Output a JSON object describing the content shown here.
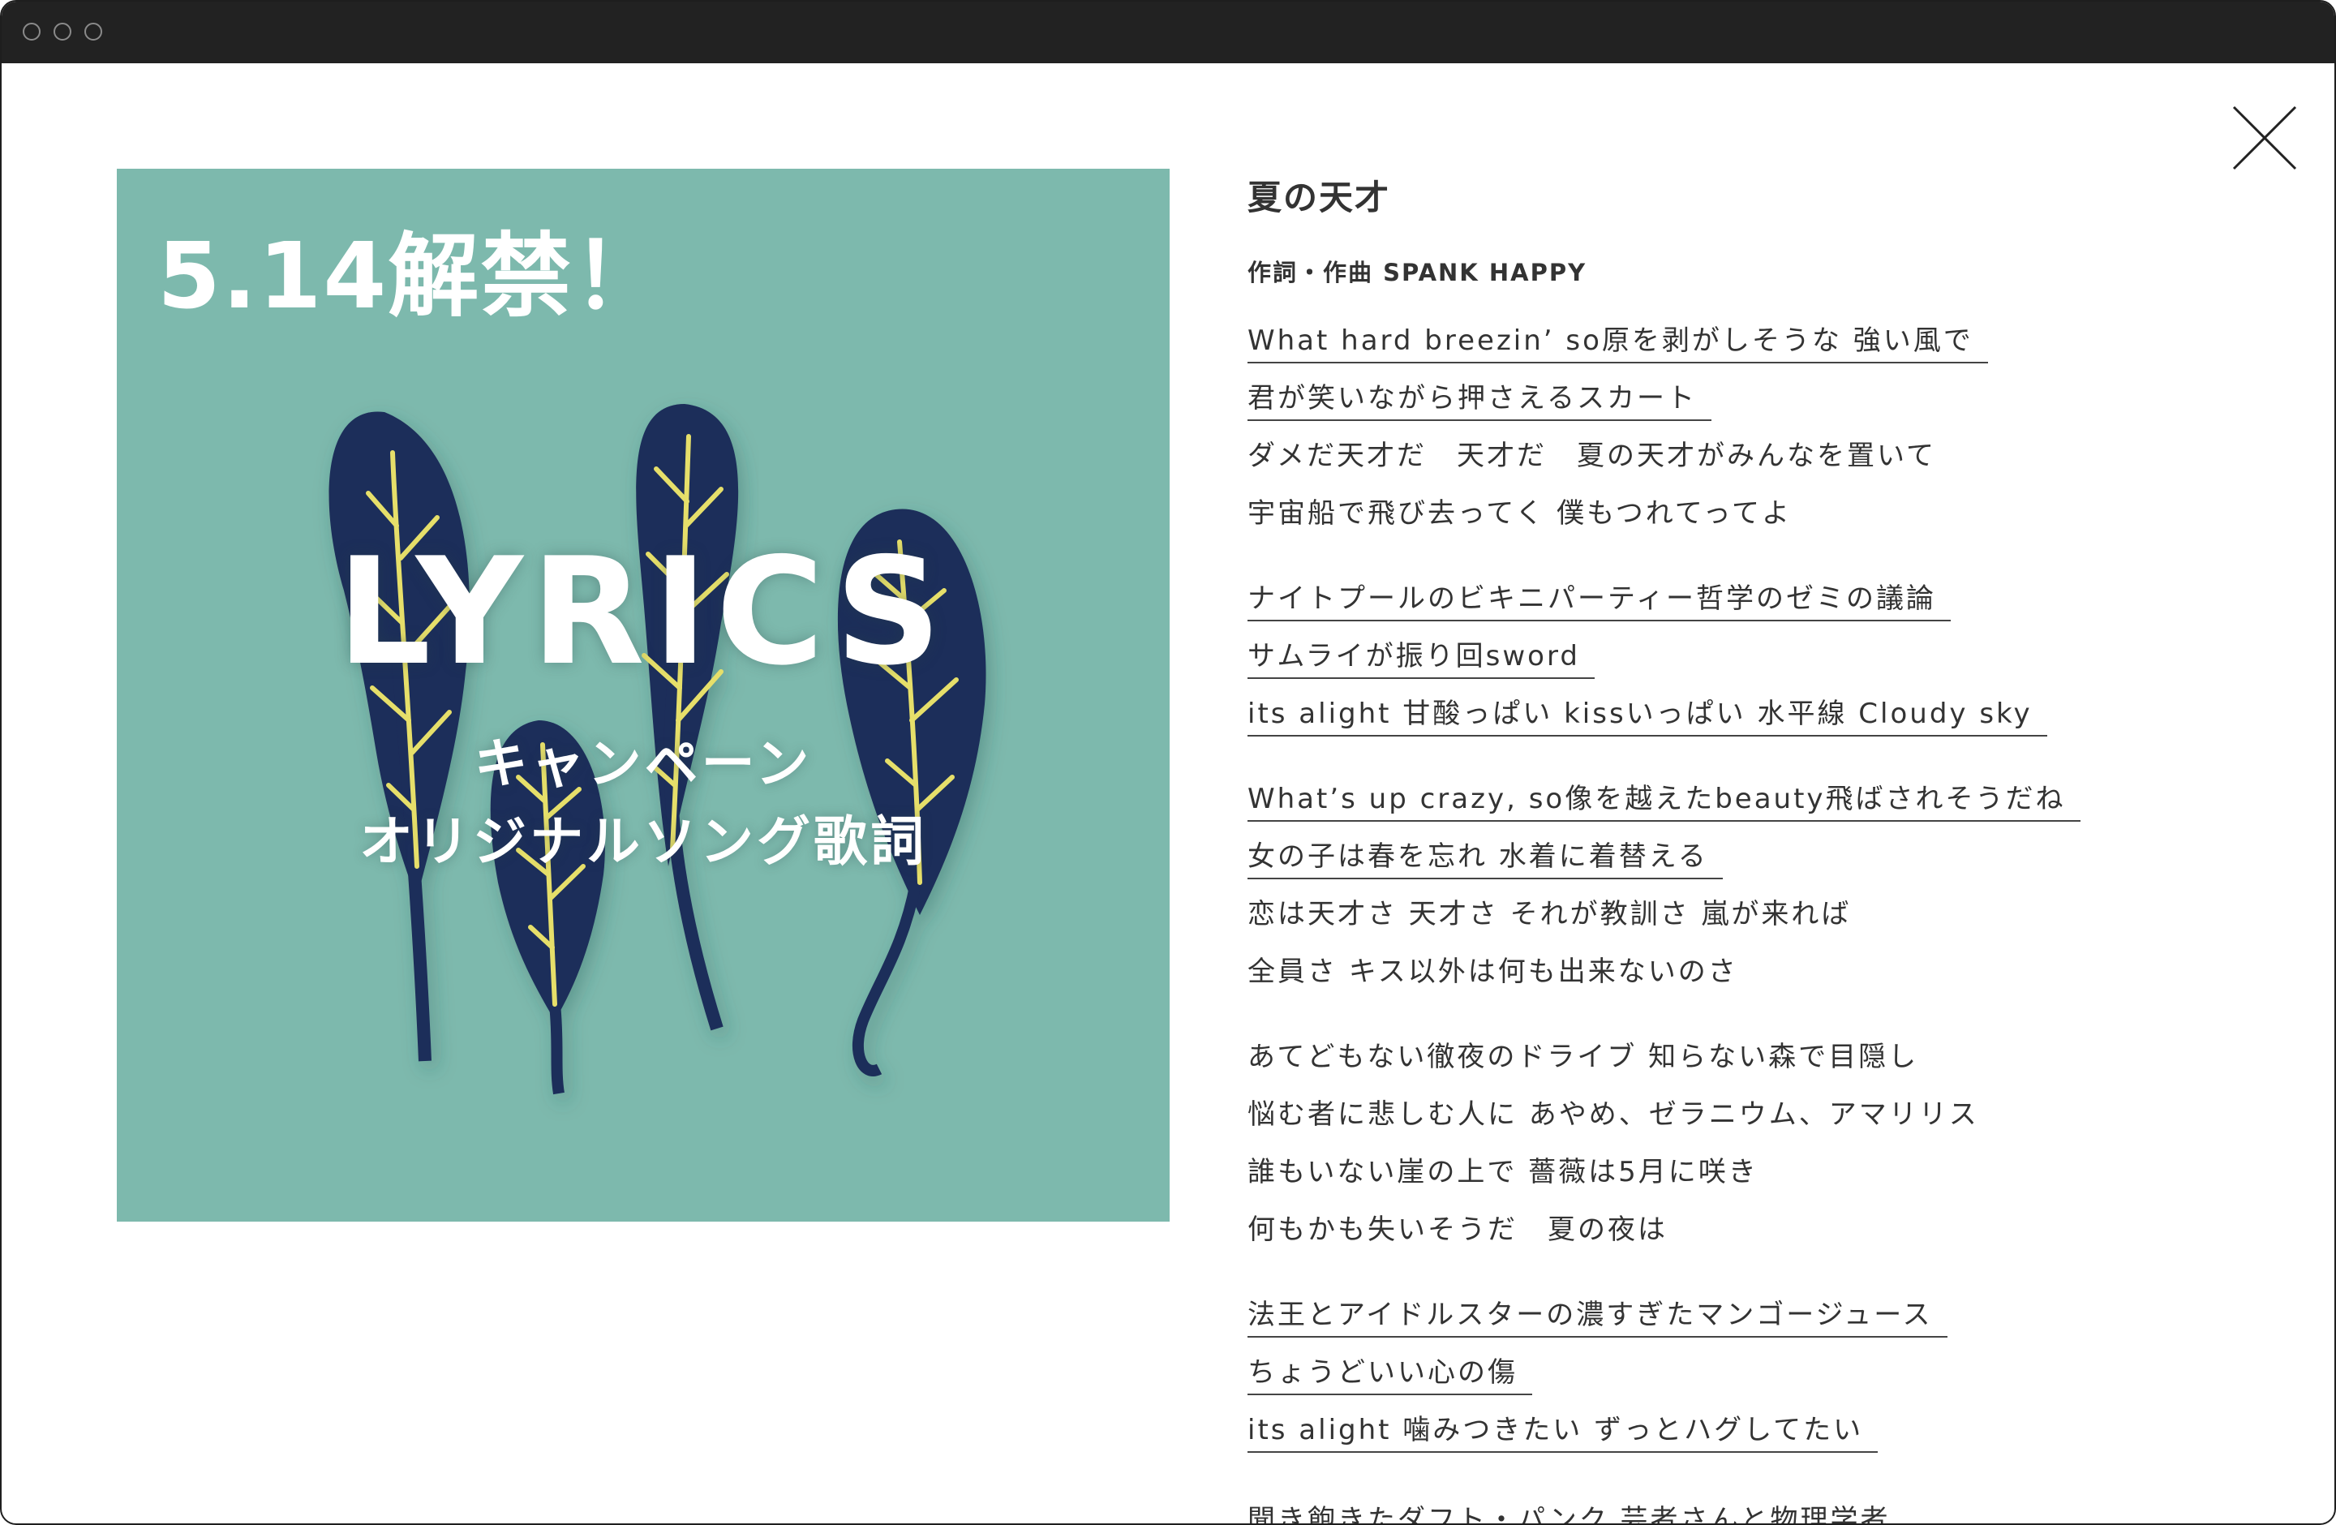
{
  "window": {
    "title": "",
    "controls": [
      "window-control",
      "window-control",
      "window-control"
    ]
  },
  "artwork": {
    "date_text": "5.14解禁！",
    "title_text": "LYRICS",
    "subtitle_line1": "キャンペーン",
    "subtitle_line2": "オリジナルソング歌詞",
    "background_color": "#7db9ad",
    "leaf_color": "#1c2d5a",
    "vein_color": "#e6df6a"
  },
  "close_icon": "close-icon",
  "song": {
    "title": "夏の天才",
    "credit": "作詞・作曲 SPANK HAPPY",
    "stanzas": [
      {
        "lines": [
          {
            "text": "What hard breezin’ so原を剥がしそうな 強い風で",
            "underlined": true
          },
          {
            "text": "君が笑いながら押さえるスカート",
            "underlined": true
          },
          {
            "text": "ダメだ天才だ　天才だ　夏の天才がみんなを置いて",
            "underlined": false
          },
          {
            "text": "宇宙船で飛び去ってく 僕もつれてってよ",
            "underlined": false
          }
        ]
      },
      {
        "lines": [
          {
            "text": "ナイトプールのビキニパーティー哲学のゼミの議論",
            "underlined": true
          },
          {
            "text": "サムライが振り回sword",
            "underlined": true
          },
          {
            "text": "its alight 甘酸っぱい kissいっぱい 水平線 Cloudy sky",
            "underlined": true
          }
        ]
      },
      {
        "lines": [
          {
            "text": "What’s up crazy, so像を越えたbeauty飛ばされそうだね",
            "underlined": true
          },
          {
            "text": "女の子は春を忘れ 水着に着替える",
            "underlined": true
          },
          {
            "text": "恋は天才さ 天才さ それが教訓さ 嵐が来れば",
            "underlined": false
          },
          {
            "text": "全員さ キス以外は何も出来ないのさ",
            "underlined": false
          }
        ]
      },
      {
        "lines": [
          {
            "text": "あてどもない徹夜のドライブ 知らない森で目隠し",
            "underlined": false
          },
          {
            "text": "悩む者に悲しむ人に あやめ、ゼラニウム、アマリリス",
            "underlined": false
          },
          {
            "text": "誰もいない崖の上で 薔薇は5月に咲き",
            "underlined": false
          },
          {
            "text": "何もかも失いそうだ　夏の夜は",
            "underlined": false
          }
        ]
      },
      {
        "lines": [
          {
            "text": "法王とアイドルスターの濃すぎたマンゴージュース",
            "underlined": true
          },
          {
            "text": "ちょうどいい心の傷",
            "underlined": true
          },
          {
            "text": "its alight 噛みつきたい ずっとハグしてたい",
            "underlined": true
          }
        ]
      }
    ],
    "cut_off_line": "聞き飽きたダフト・パンク 芸者さんと物理学者"
  }
}
